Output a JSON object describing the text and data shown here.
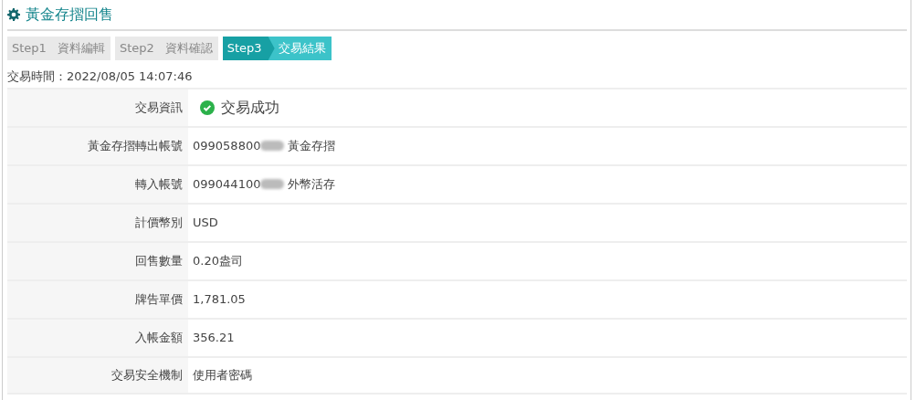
{
  "title": "黃金存摺回售",
  "steps": [
    {
      "step": "Step1",
      "label": "資料編輯",
      "selected": false
    },
    {
      "step": "Step2",
      "label": "資料確認",
      "selected": false
    },
    {
      "step": "Step3",
      "label": "交易結果",
      "selected": true
    }
  ],
  "transaction_time": "交易時間：2022/08/05 14:07:46",
  "rows": [
    {
      "kind": "status",
      "label": "交易資訊",
      "value": "交易成功"
    },
    {
      "kind": "account",
      "label": "黃金存摺轉出帳號",
      "value": "099058800",
      "masked": true,
      "account_type": "黃金存摺"
    },
    {
      "kind": "account",
      "label": "轉入帳號",
      "value": "099044100",
      "masked": true,
      "account_type": "外幣活存"
    },
    {
      "kind": "text",
      "label": "計價幣別",
      "value": "USD"
    },
    {
      "kind": "text",
      "label": "回售數量",
      "value": "0.20盎司"
    },
    {
      "kind": "text",
      "label": "牌告單價",
      "value": "1,781.05"
    },
    {
      "kind": "text",
      "label": "入帳金額",
      "value": "356.21"
    },
    {
      "kind": "text",
      "label": "交易安全機制",
      "value": "使用者密碼"
    }
  ]
}
